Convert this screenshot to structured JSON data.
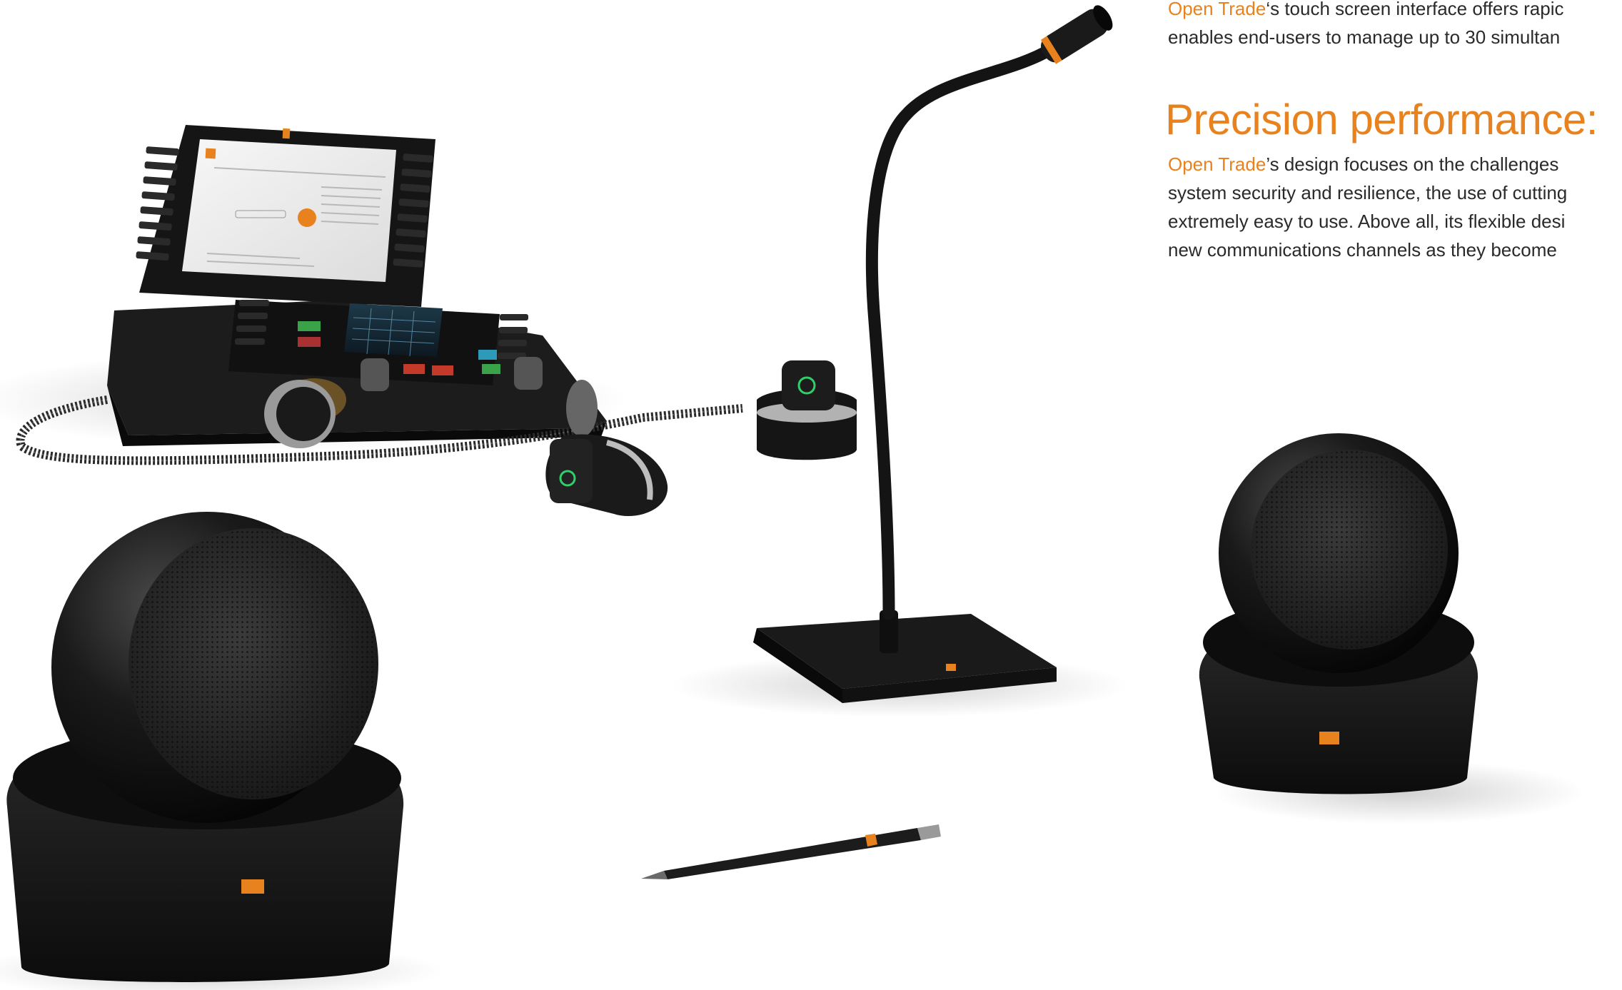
{
  "brand": "Open Trade",
  "intro": {
    "line1_rest": "‘s touch screen interface offers rapic",
    "line2": "enables end-users to manage up to 30 simultan"
  },
  "heading": "Precision performance:",
  "body": {
    "line1_rest": "’s design focuses on the challenges",
    "line2": "system security and resilience, the use of cutting",
    "line3": "extremely easy to use. Above all, its flexible desi",
    "line4": "new communications channels as they become"
  },
  "colors": {
    "accent": "#e8821e",
    "product": "#121212",
    "background": "#ffffff"
  }
}
